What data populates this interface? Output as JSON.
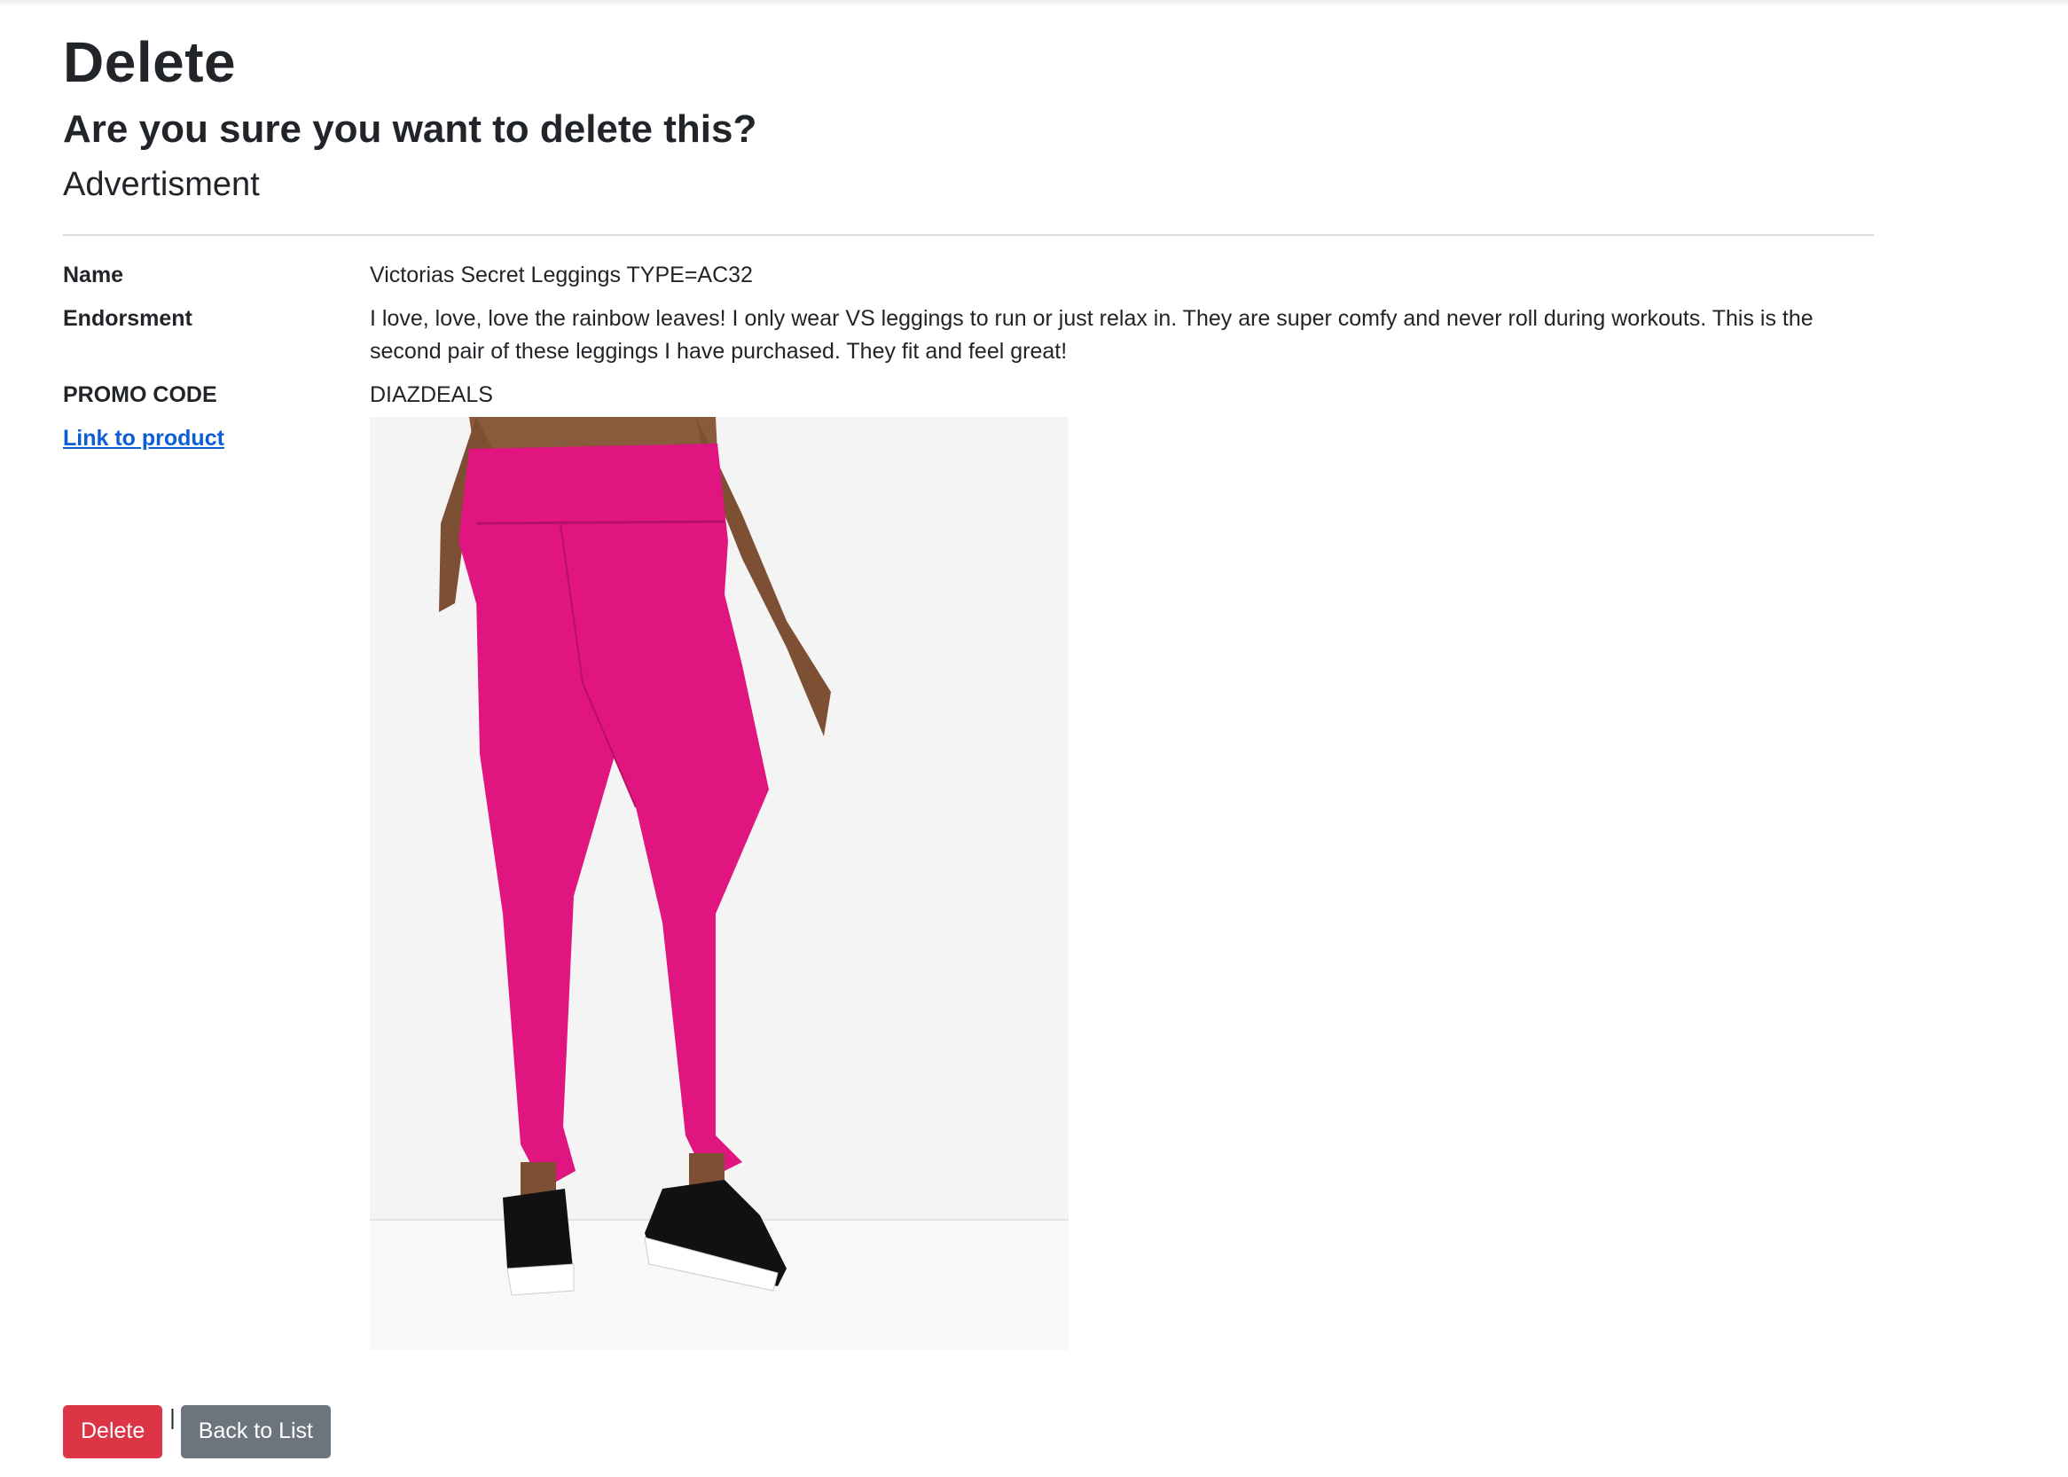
{
  "page": {
    "title": "Delete",
    "question": "Are you sure you want to delete this?",
    "section": "Advertisment"
  },
  "details": {
    "name_label": "Name",
    "name_value": "Victorias Secret Leggings TYPE=AC32",
    "endorsement_label": "Endorsment",
    "endorsement_value": "I love, love, love the rainbow leaves! I only wear VS leggings to run or just relax in. They are super comfy and never roll during workouts. This is the second pair of these leggings I have purchased. They fit and feel great!",
    "promo_label": "PROMO CODE",
    "promo_value": "DIAZDEALS",
    "link_label": "Link to product"
  },
  "actions": {
    "delete_label": "Delete",
    "separator": "|",
    "back_label": "Back to List"
  },
  "colors": {
    "danger": "#dc3545",
    "secondary": "#6c757d",
    "link": "#0b5ed7",
    "leggings": "#e0157f"
  }
}
